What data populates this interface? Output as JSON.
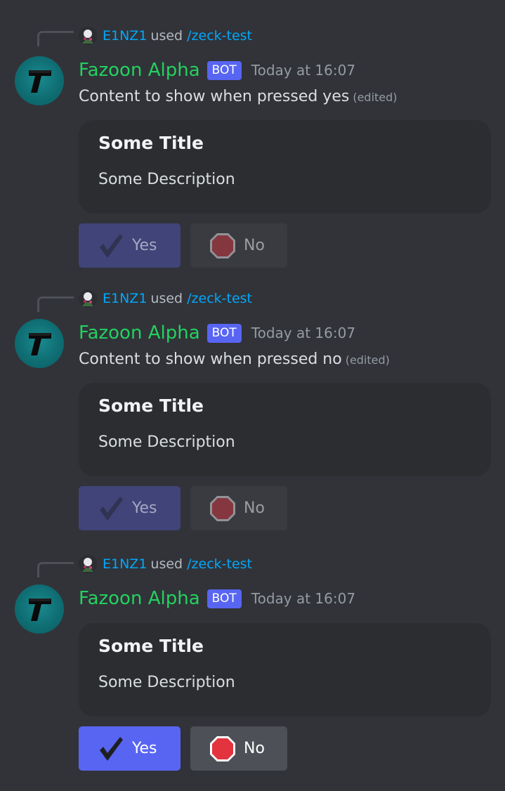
{
  "colors": {
    "background": "#313338",
    "embed": "#2b2d31",
    "username": "#23d160",
    "link": "#00a8fc",
    "blurple": "#5865f2",
    "secondary_button": "#4e5058",
    "stop_red": "#e2333f"
  },
  "messages": [
    {
      "reply": {
        "user": "E1NZ1",
        "used": "used",
        "command": "/zeck-test"
      },
      "author": "Fazoon Alpha",
      "bot_tag": "BOT",
      "timestamp": "Today at 16:07",
      "content": "Content to show when pressed yes",
      "edited": "(edited)",
      "embed": {
        "title": "Some Title",
        "description": "Some Description"
      },
      "buttons": {
        "yes": {
          "label": "Yes",
          "icon": "check-icon",
          "disabled": true
        },
        "no": {
          "label": "No",
          "icon": "stop-sign-icon",
          "disabled": true
        }
      }
    },
    {
      "reply": {
        "user": "E1NZ1",
        "used": "used",
        "command": "/zeck-test"
      },
      "author": "Fazoon Alpha",
      "bot_tag": "BOT",
      "timestamp": "Today at 16:07",
      "content": "Content to show when pressed no",
      "edited": "(edited)",
      "embed": {
        "title": "Some Title",
        "description": "Some Description"
      },
      "buttons": {
        "yes": {
          "label": "Yes",
          "icon": "check-icon",
          "disabled": true
        },
        "no": {
          "label": "No",
          "icon": "stop-sign-icon",
          "disabled": true
        }
      }
    },
    {
      "reply": {
        "user": "E1NZ1",
        "used": "used",
        "command": "/zeck-test"
      },
      "author": "Fazoon Alpha",
      "bot_tag": "BOT",
      "timestamp": "Today at 16:07",
      "embed": {
        "title": "Some Title",
        "description": "Some Description"
      },
      "buttons": {
        "yes": {
          "label": "Yes",
          "icon": "check-icon",
          "disabled": false
        },
        "no": {
          "label": "No",
          "icon": "stop-sign-icon",
          "disabled": false
        }
      }
    }
  ]
}
